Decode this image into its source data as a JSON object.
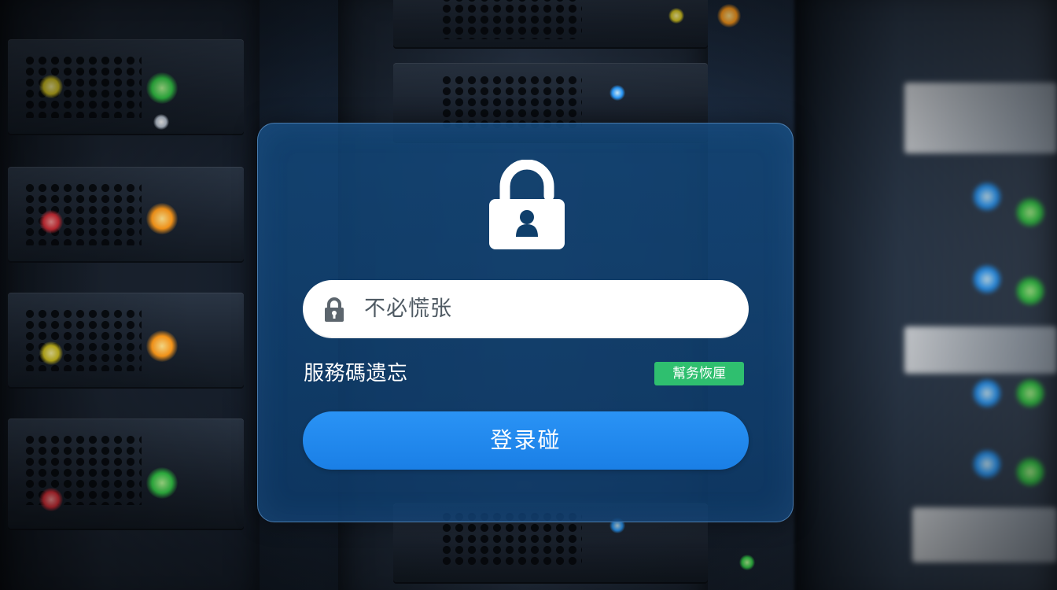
{
  "login_dialog": {
    "password_field": {
      "value": "不必慌张"
    },
    "forgot_link": "服務碼遗忘",
    "help_badge": "幫务恢厘",
    "login_button": "登录碰"
  },
  "colors": {
    "dialog_background": "#124678",
    "input_background": "#ffffff",
    "badge_green": "#2fbf6f",
    "button_blue": "#1a7fe6"
  },
  "icons": {
    "dialog_header": "padlock-icon",
    "field_prefix": "lock-icon"
  }
}
